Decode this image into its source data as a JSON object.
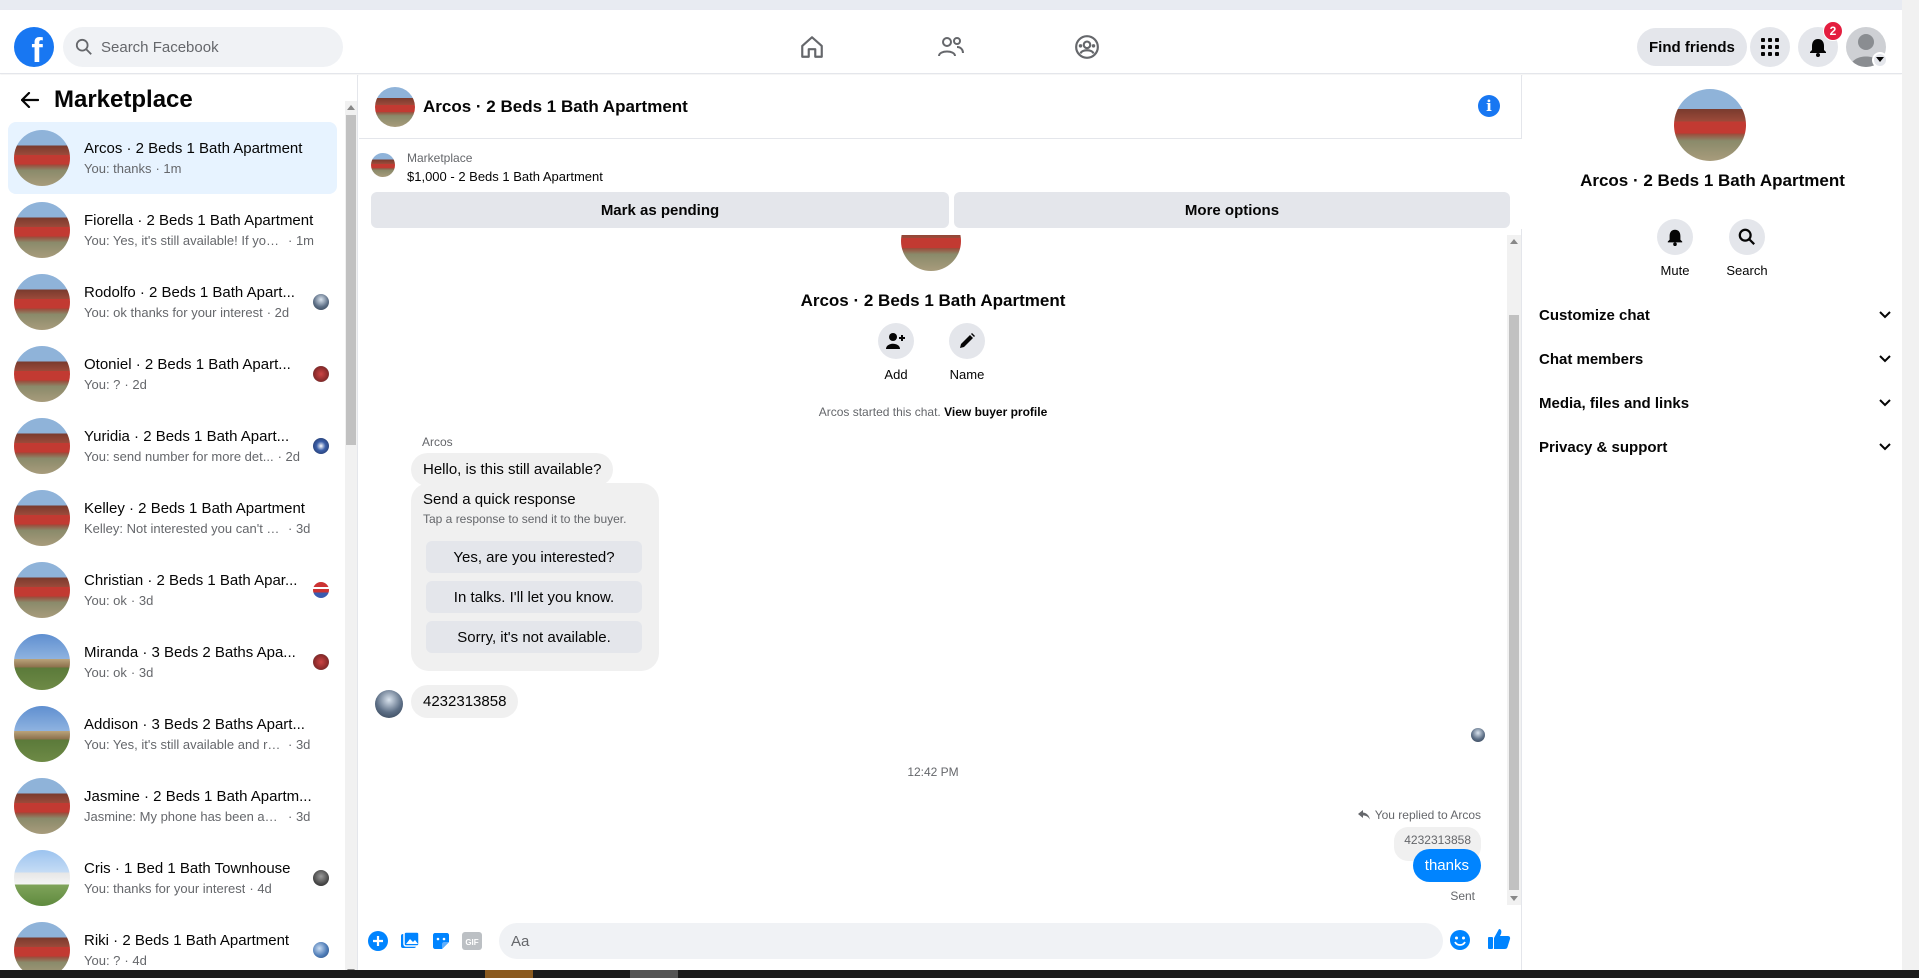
{
  "nav": {
    "search_placeholder": "Search Facebook",
    "find_friends": "Find friends",
    "notifications_count": "2",
    "brand_color": "#1877f2"
  },
  "sidebar": {
    "title": "Marketplace",
    "conversations": [
      {
        "name": "Arcos · 2 Beds 1 Bath Apartment",
        "message": "You: thanks",
        "time": "· 1m"
      },
      {
        "name": "Fiorella · 2 Beds 1 Bath Apartment",
        "message": "You: Yes, it's still available! If you f...",
        "time": "· 1m"
      },
      {
        "name": "Rodolfo · 2 Beds 1 Bath Apart...",
        "message": "You: ok thanks for your interest",
        "time": "· 2d"
      },
      {
        "name": "Otoniel · 2 Beds 1 Bath Apart...",
        "message": "You: ?",
        "time": "· 2d"
      },
      {
        "name": "Yuridia · 2 Beds 1 Bath Apart...",
        "message": "You: send number for more det...",
        "time": "· 2d"
      },
      {
        "name": "Kelley · 2 Beds 1 Bath Apartment",
        "message": "Kelley: Not interested you can't ev...",
        "time": "· 3d"
      },
      {
        "name": "Christian · 2 Beds 1 Bath Apar...",
        "message": "You: ok",
        "time": "· 3d"
      },
      {
        "name": "Miranda · 3 Beds 2 Baths Apa...",
        "message": "You: ok",
        "time": "· 3d"
      },
      {
        "name": "Addison · 3 Beds 2 Baths Apart...",
        "message": "You: Yes, it's still available and read...",
        "time": "· 3d"
      },
      {
        "name": "Jasmine · 2 Beds 1 Bath Apartm...",
        "message": "Jasmine: My phone has been actin...",
        "time": "· 3d"
      },
      {
        "name": "Cris · 1 Bed 1 Bath Townhouse",
        "message": "You: thanks for your interest",
        "time": "· 4d"
      },
      {
        "name": "Riki · 2 Beds 1 Bath Apartment",
        "message": "You: ?",
        "time": "· 4d"
      }
    ]
  },
  "chat": {
    "title": "Arcos · 2 Beds 1 Bath Apartment",
    "marketplace_label": "Marketplace",
    "listing": "$1,000 - 2 Beds 1 Bath Apartment",
    "mark_pending": "Mark as pending",
    "more_options": "More options",
    "intro_title": "Arcos · 2 Beds 1 Bath Apartment",
    "add_label": "Add",
    "name_label": "Name",
    "started_text": "Arcos started this chat.",
    "view_profile": "View buyer profile",
    "sender": "Arcos",
    "msg1": "Hello, is this still available?",
    "quick_title": "Send a quick response",
    "quick_sub": "Tap a response to send it to the buyer.",
    "quick_options": [
      "Yes, are you interested?",
      "In talks. I'll let you know.",
      "Sorry, it's not available."
    ],
    "msg2": "4232313858",
    "time_sep": "12:42 PM",
    "replied": "You replied to Arcos",
    "quoted": "4232313858",
    "out_msg": "thanks",
    "sent": "Sent",
    "composer_placeholder": "Aa"
  },
  "right_panel": {
    "name": "Arcos · 2 Beds 1 Bath Apartment",
    "mute": "Mute",
    "search": "Search",
    "sections": [
      "Customize chat",
      "Chat members",
      "Media, files and links",
      "Privacy & support"
    ]
  }
}
